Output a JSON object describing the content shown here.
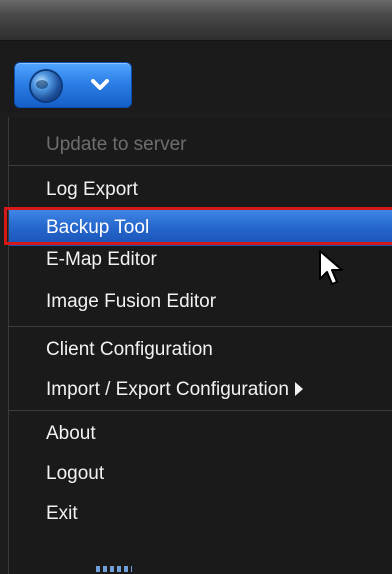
{
  "menu_button": {
    "globe_icon": "globe-icon",
    "chevron_icon": "chevron-down-icon",
    "accent_color": "#2c7fe6"
  },
  "menu": {
    "items": [
      {
        "label": "Update to server",
        "disabled": true
      },
      {
        "label": "Log Export"
      },
      {
        "label": "Backup Tool",
        "selected": true
      },
      {
        "label": "E-Map Editor"
      },
      {
        "label": "Image Fusion Editor"
      },
      {
        "label": "Client Configuration"
      },
      {
        "label": "Import / Export Configuration",
        "submenu": true
      },
      {
        "label": "About"
      },
      {
        "label": "Logout"
      },
      {
        "label": "Exit"
      }
    ],
    "selected_color": "#2566cc",
    "highlight_color": "#d51919"
  }
}
